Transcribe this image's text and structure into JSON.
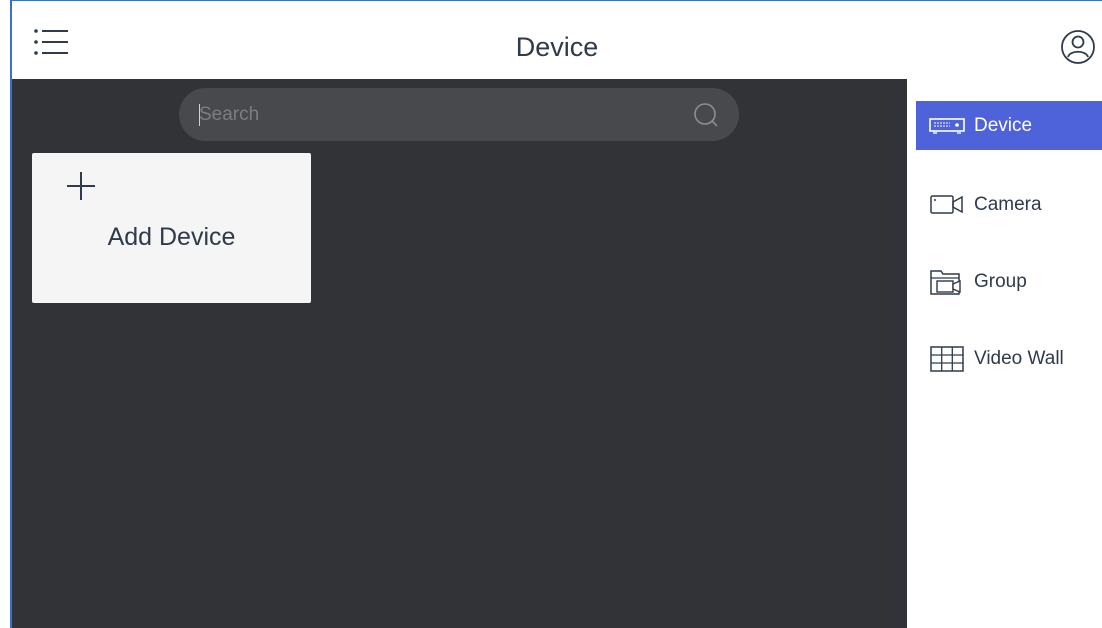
{
  "header": {
    "title": "Device"
  },
  "search": {
    "placeholder": "Search"
  },
  "main": {
    "add_card_label": "Add Device"
  },
  "sidebar": {
    "items": [
      {
        "label": "Device",
        "icon": "dvr-icon",
        "active": true
      },
      {
        "label": "Camera",
        "icon": "camera-icon",
        "active": false
      },
      {
        "label": "Group",
        "icon": "group-folder-icon",
        "active": false
      },
      {
        "label": "Video Wall",
        "icon": "video-wall-icon",
        "active": false
      }
    ]
  },
  "colors": {
    "accent": "#4e63d9",
    "dark_background": "#323337",
    "search_background": "#48494d",
    "text_primary": "#2f3a4a",
    "card_background": "#f5f5f6"
  }
}
